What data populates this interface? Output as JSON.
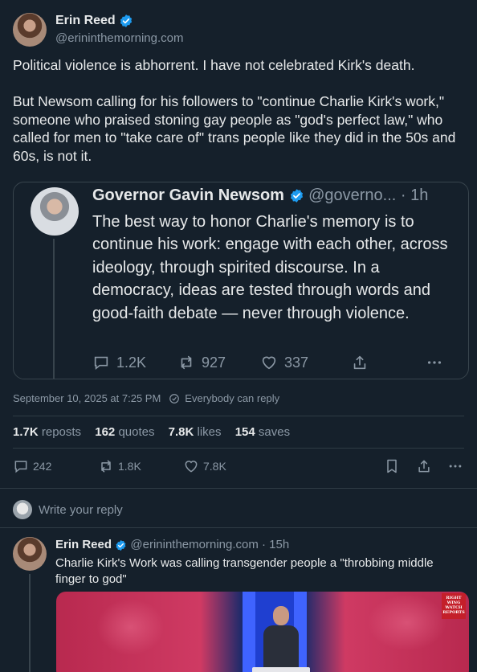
{
  "main_post": {
    "author_name": "Erin Reed",
    "author_handle": "@erininthemorning.com",
    "text": "Political violence is abhorrent. I have not celebrated Kirk's death.\n\nBut Newsom calling for his followers to \"continue Charlie Kirk's work,\" someone who praised stoning gay people as \"god's perfect law,\" who called for men to \"take care of\" trans people like they did in the 50s and 60s, is not it.",
    "timestamp": "September 10, 2025 at 7:25 PM",
    "reply_setting": "Everybody can reply"
  },
  "quoted_post": {
    "author_name": "Governor Gavin Newsom",
    "author_handle": "@governo...",
    "time_ago": "· 1h",
    "text": "The best way to honor Charlie's memory is to continue his work: engage with each other, across ideology, through spirited discourse. In a democracy, ideas are tested through words and good-faith debate — never through violence.",
    "replies": "1.2K",
    "reposts": "927",
    "likes": "337"
  },
  "stats": {
    "reposts_value": "1.7K",
    "reposts_label": "reposts",
    "quotes_value": "162",
    "quotes_label": "quotes",
    "likes_value": "7.8K",
    "likes_label": "likes",
    "saves_value": "154",
    "saves_label": "saves"
  },
  "actions": {
    "replies": "242",
    "reposts": "1.8K",
    "likes": "7.8K"
  },
  "compose": {
    "placeholder": "Write your reply"
  },
  "reply_post": {
    "author_name": "Erin Reed",
    "author_handle": "@erininthemorning.com",
    "time_ago": "· 15h",
    "text": "Charlie Kirk's Work was calling transgender people a \"throbbing middle finger to god\"",
    "media_logo_text": "RIGHT WING WATCH REPORTS"
  },
  "colors": {
    "background": "#15202b",
    "verified": "#1d9bf0",
    "muted": "#8b98a5",
    "border": "#38444d"
  }
}
